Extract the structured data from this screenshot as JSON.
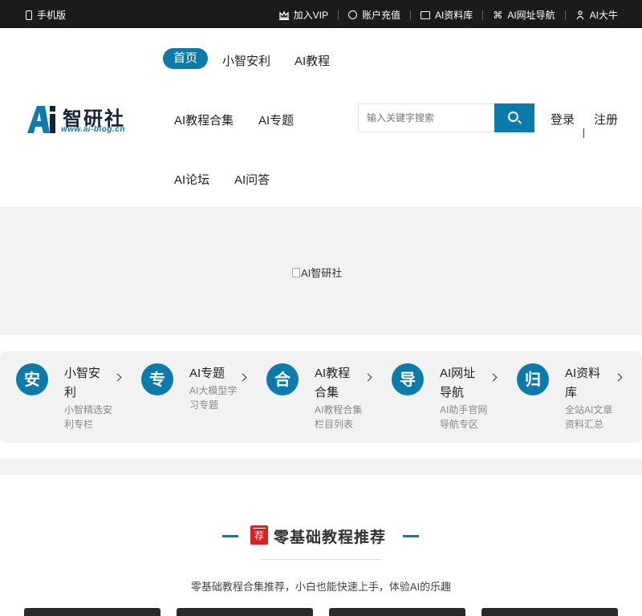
{
  "topbar": {
    "mobile_label": "手机版",
    "links": [
      {
        "icon": "crown-icon",
        "label": "加入VIP"
      },
      {
        "icon": "coin-icon",
        "label": "账户充值"
      },
      {
        "icon": "folder-icon",
        "label": "AI资料库"
      },
      {
        "icon": "command-icon",
        "label": "AI网址导航"
      },
      {
        "icon": "people-icon",
        "label": "AI大牛"
      }
    ]
  },
  "logo": {
    "mark": "Ai",
    "name": "智研社",
    "url": "www.ai-blog.cn"
  },
  "nav": {
    "items": [
      "首页",
      "小智安利",
      "AI教程",
      "AI教程合集",
      "AI专题",
      "AI论坛",
      "AI问答"
    ],
    "active": "首页"
  },
  "search": {
    "placeholder": "输入关键字搜索"
  },
  "auth": {
    "login": "登录",
    "register": "注册"
  },
  "banner": {
    "alt": "AI智研社"
  },
  "categories": [
    {
      "glyph": "安",
      "title": "小智安利",
      "desc": "小智精选安利专栏"
    },
    {
      "glyph": "专",
      "title": "AI专题",
      "desc": "AI大模型学习专题"
    },
    {
      "glyph": "合",
      "title": "AI教程合集",
      "desc": "AI教程合集栏目列表"
    },
    {
      "glyph": "导",
      "title": "AI网址导航",
      "desc": "AI助手官网导航专区"
    },
    {
      "glyph": "归",
      "title": "AI资料库",
      "desc": "全站AI文章资料汇总"
    }
  ],
  "section": {
    "badge": "荐",
    "title": "零基础教程推荐",
    "subtitle": "零基础教程合集推荐，小白也能快速上手，体验AI的乐趣"
  },
  "colors": {
    "accent": "#0a7bab",
    "topbar": "#1b1b1b",
    "badge": "#d7201f"
  }
}
